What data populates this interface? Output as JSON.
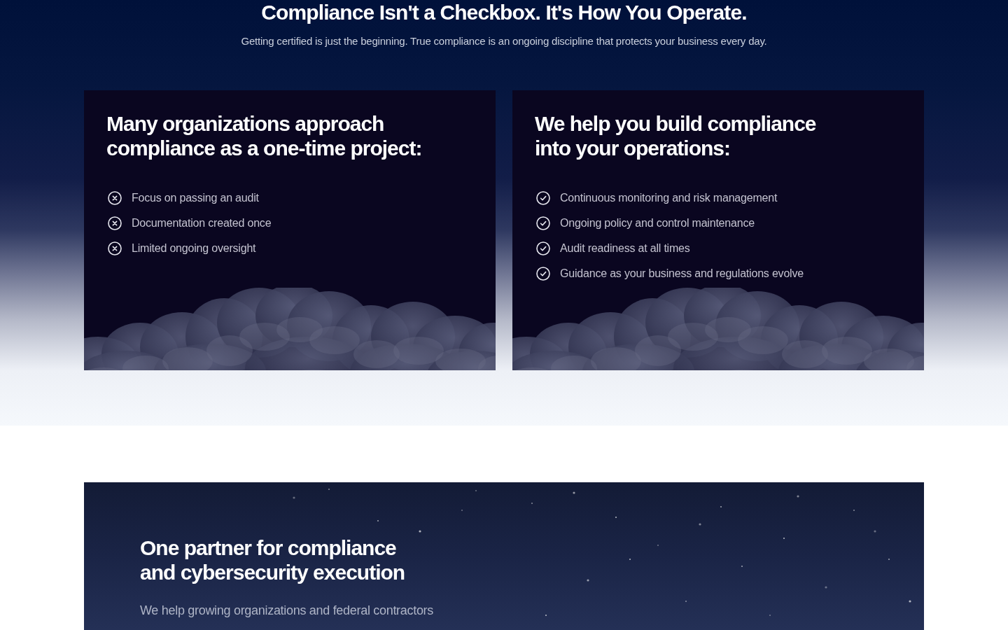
{
  "section": {
    "title": "Compliance Isn't a Checkbox. It's How You Operate.",
    "subtitle": "Getting certified is just the beginning. True compliance is an ongoing discipline that protects your business every day."
  },
  "cards": [
    {
      "kind": "cross",
      "heading": "Many organizations approach compliance as a one-time project:",
      "items": [
        "Focus on passing an audit",
        "Documentation created once",
        "Limited ongoing oversight"
      ]
    },
    {
      "kind": "check",
      "heading": "We help you build compliance into your operations:",
      "items": [
        "Continuous monitoring and risk management",
        "Ongoing policy and control maintenance",
        "Audit readiness at all times",
        "Guidance as your business and regulations evolve"
      ]
    }
  ],
  "partner": {
    "heading": "One partner for compliance and cybersecurity execution",
    "text": "We help growing organizations and federal contractors"
  }
}
